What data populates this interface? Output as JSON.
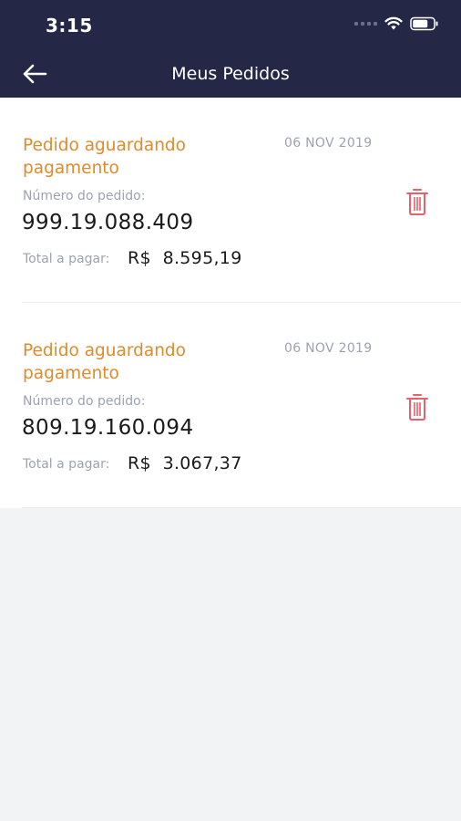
{
  "status_bar": {
    "time": "3:15",
    "icons": [
      "signal-dots-icon",
      "wifi-icon",
      "battery-icon"
    ]
  },
  "header": {
    "title": "Meus Pedidos",
    "back_icon": "arrow-left-icon"
  },
  "orders": [
    {
      "status": "Pedido aguardando pagamento",
      "date": "06 NOV 2019",
      "number_label": "Número do pedido:",
      "number": "999.19.088.409",
      "total_label": "Total a pagar:",
      "total": "R$  8.595,19",
      "delete_icon": "trash-icon"
    },
    {
      "status": "Pedido aguardando pagamento",
      "date": "06 NOV 2019",
      "number_label": "Número do pedido:",
      "number": "809.19.160.094",
      "total_label": "Total a pagar:",
      "total": "R$  3.067,37",
      "delete_icon": "trash-icon"
    }
  ],
  "colors": {
    "header_bg": "#242846",
    "status_orange": "#e08a2a",
    "muted_gray": "#9ca3b0",
    "trash_red": "#e8606a",
    "page_bg": "#f2f3f5"
  }
}
